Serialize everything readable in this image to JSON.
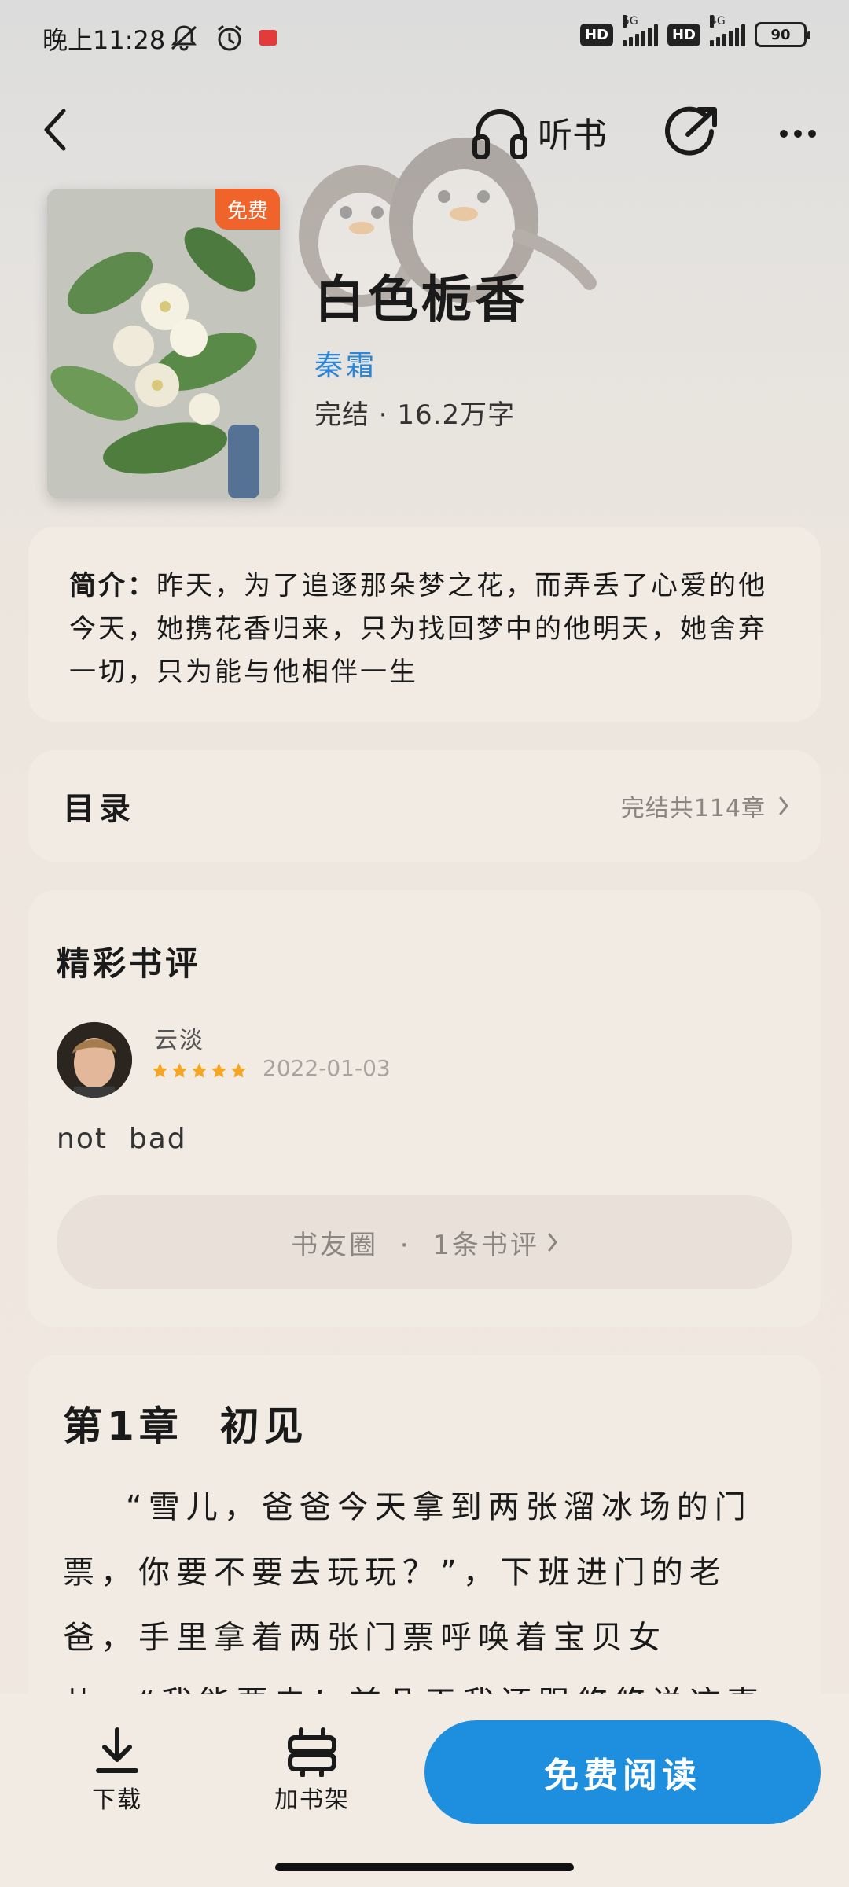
{
  "status_bar": {
    "time": "晚上11:28",
    "network_1": "5G",
    "network_2": "4G",
    "hd": "HD",
    "battery": "90"
  },
  "nav": {
    "listen_label": "听书"
  },
  "book": {
    "title": "白色栀香",
    "author": "秦霜",
    "meta": "完结 · 16.2万字",
    "badge": "免费"
  },
  "intro": {
    "label": "简介：",
    "text": "昨天，为了追逐那朵梦之花，而弄丢了心爱的他今天，她携花香归来，只为找回梦中的他明天，她舍弃一切，只为能与他相伴一生"
  },
  "toc": {
    "title": "目录",
    "summary": "完结共114章"
  },
  "reviews": {
    "title": "精彩书评",
    "items": [
      {
        "user": "云淡",
        "rating": 5,
        "date": "2022-01-03",
        "text": "not  bad"
      }
    ],
    "circle_label": "书友圈  ·  1条书评"
  },
  "chapter": {
    "title": "第1章  初见",
    "body": "“雪儿，爸爸今天拿到两张溜冰场的门票，你要不要去玩玩？”，下班进门的老爸，手里拿着两张门票呼唤着宝贝女儿。“我能要去！前几天我还跟悠悠说这事"
  },
  "bottom": {
    "download_label": "下载",
    "shelf_label": "加书架",
    "read_label": "免费阅读"
  },
  "colors": {
    "accent_blue": "#1e8fdf",
    "author_blue": "#2b86d6",
    "badge_orange": "#f0642c",
    "star_orange": "#f5a623"
  }
}
